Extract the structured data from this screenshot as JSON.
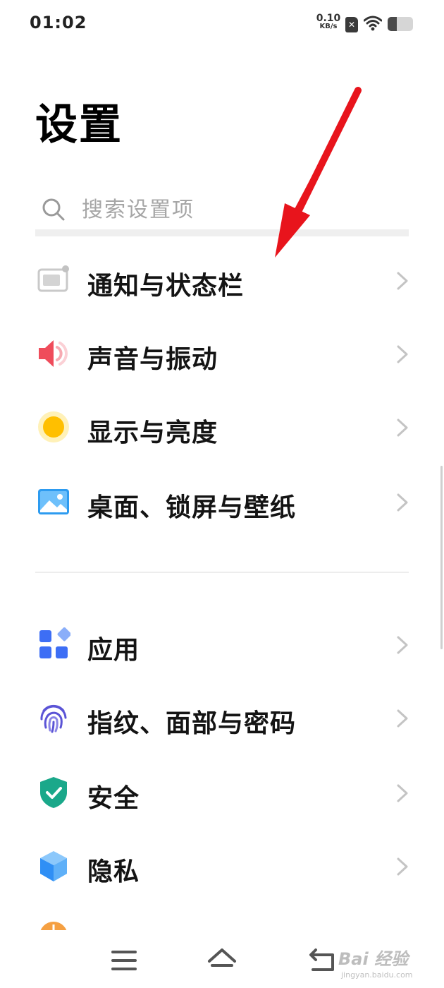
{
  "status_bar": {
    "time": "01:02",
    "net_speed_value": "0.10",
    "net_speed_unit": "KB/s",
    "sim_icon": "no-sim-icon",
    "wifi_icon": "wifi-icon",
    "battery_level": 0.35
  },
  "page": {
    "title": "设置"
  },
  "search": {
    "placeholder": "搜索设置项",
    "value": ""
  },
  "menu_groups": [
    {
      "items": [
        {
          "label": "通知与状态栏",
          "icon": "notification-icon"
        },
        {
          "label": "声音与振动",
          "icon": "speaker-icon"
        },
        {
          "label": "显示与亮度",
          "icon": "brightness-icon"
        },
        {
          "label": "桌面、锁屏与壁纸",
          "icon": "wallpaper-icon"
        }
      ]
    },
    {
      "items": [
        {
          "label": "应用",
          "icon": "apps-icon"
        },
        {
          "label": "指纹、面部与密码",
          "icon": "fingerprint-icon"
        },
        {
          "label": "安全",
          "icon": "shield-icon"
        },
        {
          "label": "隐私",
          "icon": "privacy-cube-icon"
        }
      ]
    }
  ],
  "colors": {
    "annotation_arrow": "#e8141c",
    "speaker": "#ef4c5b",
    "brightness": "#ffbf00",
    "wallpaper": "#2d9bf0",
    "apps": "#3d6ef5",
    "fingerprint": "#5b54d6",
    "shield": "#1aa88a",
    "privacy": "#2f8ff5"
  },
  "nav_bar": {
    "menu_icon": "menu-icon",
    "home_icon": "home-icon",
    "back_icon": "back-icon"
  },
  "watermark": {
    "brand": "Bai 经验",
    "url": "jingyan.baidu.com"
  }
}
